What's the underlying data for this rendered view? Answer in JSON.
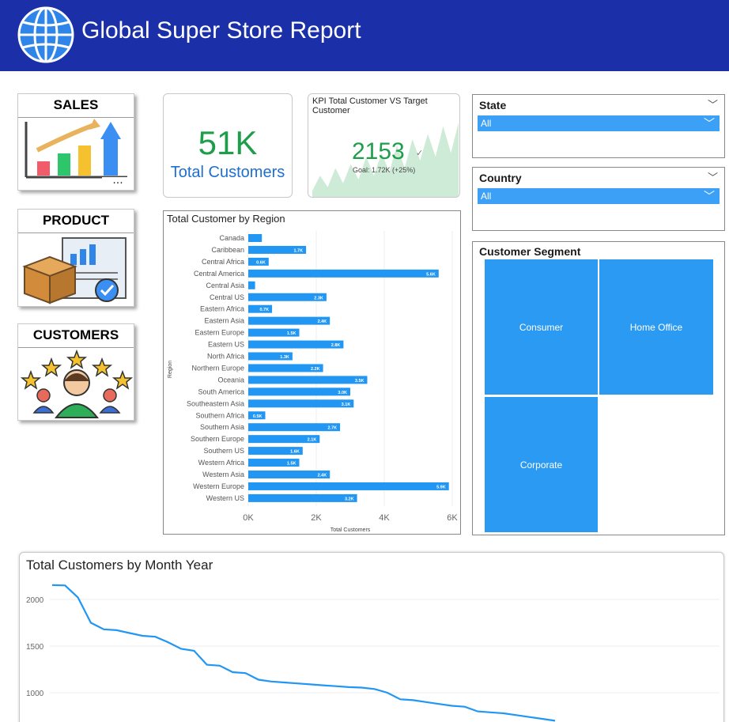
{
  "header": {
    "title": "Global Super Store Report",
    "icon": "globe-icon"
  },
  "nav": {
    "sales_label": "SALES",
    "product_label": "PRODUCT",
    "customers_label": "CUSTOMERS",
    "more_options": "..."
  },
  "kpi_total": {
    "value": "51K",
    "label": "Total Customers"
  },
  "kpi_target": {
    "title": "KPI Total Customer VS Target Customer",
    "value": "2153",
    "goal": "Goal: 1.72K (+25%)"
  },
  "slicers": {
    "state": {
      "title": "State",
      "value": "All"
    },
    "country": {
      "title": "Country",
      "value": "All"
    }
  },
  "segment": {
    "title": "Customer Segment",
    "cells": [
      "Consumer",
      "Home Office",
      "Corporate"
    ]
  },
  "colors": {
    "header_bg": "#1a2fa8",
    "bar": "#2196f3",
    "kpi_green": "#1e9e4a",
    "line": "#2196f3"
  },
  "chart_data": [
    {
      "type": "bar",
      "orientation": "horizontal",
      "title": "Total Customer by Region",
      "xlabel": "Total Customers",
      "ylabel": "Region",
      "xlim": [
        0,
        6000
      ],
      "xticks": [
        "0K",
        "2K",
        "4K",
        "6K"
      ],
      "categories": [
        "Canada",
        "Caribbean",
        "Central Africa",
        "Central America",
        "Central Asia",
        "Central US",
        "Eastern Africa",
        "Eastern Asia",
        "Eastern Europe",
        "Eastern US",
        "North Africa",
        "Northern Europe",
        "Oceania",
        "South America",
        "Southeastern Asia",
        "Southern Africa",
        "Southern Asia",
        "Southern Europe",
        "Southern US",
        "Western Africa",
        "Western Asia",
        "Western Europe",
        "Western US"
      ],
      "values": [
        400,
        1700,
        600,
        5600,
        200,
        2300,
        700,
        2400,
        1500,
        2800,
        1300,
        2200,
        3500,
        3000,
        3100,
        500,
        2700,
        2100,
        1600,
        1500,
        2400,
        5900,
        3200
      ],
      "data_labels": [
        "",
        "1.7K",
        "0.6K",
        "5.6K",
        "",
        "2.3K",
        "0.7K",
        "2.4K",
        "1.5K",
        "2.8K",
        "1.3K",
        "2.2K",
        "3.5K",
        "3.0K",
        "3.1K",
        "0.5K",
        "2.7K",
        "2.1K",
        "1.6K",
        "1.5K",
        "2.4K",
        "5.9K",
        "3.2K"
      ],
      "grid": true
    },
    {
      "type": "line",
      "title": "Total Customers by Month Year",
      "yticks": [
        1000,
        1500,
        2000
      ],
      "values": [
        2153,
        2150,
        2020,
        1750,
        1680,
        1670,
        1640,
        1610,
        1600,
        1540,
        1470,
        1450,
        1300,
        1290,
        1220,
        1210,
        1140,
        1120,
        1110,
        1100,
        1090,
        1080,
        1070,
        1060,
        1055,
        1040,
        1000,
        930,
        920,
        900,
        880,
        860,
        850,
        800,
        790,
        780,
        760,
        740,
        720,
        700
      ],
      "grid": true
    },
    {
      "type": "area",
      "title": "KPI Total Customer VS Target Customer",
      "values": [
        10,
        30,
        15,
        40,
        20,
        45,
        25,
        55,
        30,
        60,
        35,
        70,
        40,
        78,
        50,
        85,
        55,
        95,
        60,
        100
      ]
    }
  ]
}
